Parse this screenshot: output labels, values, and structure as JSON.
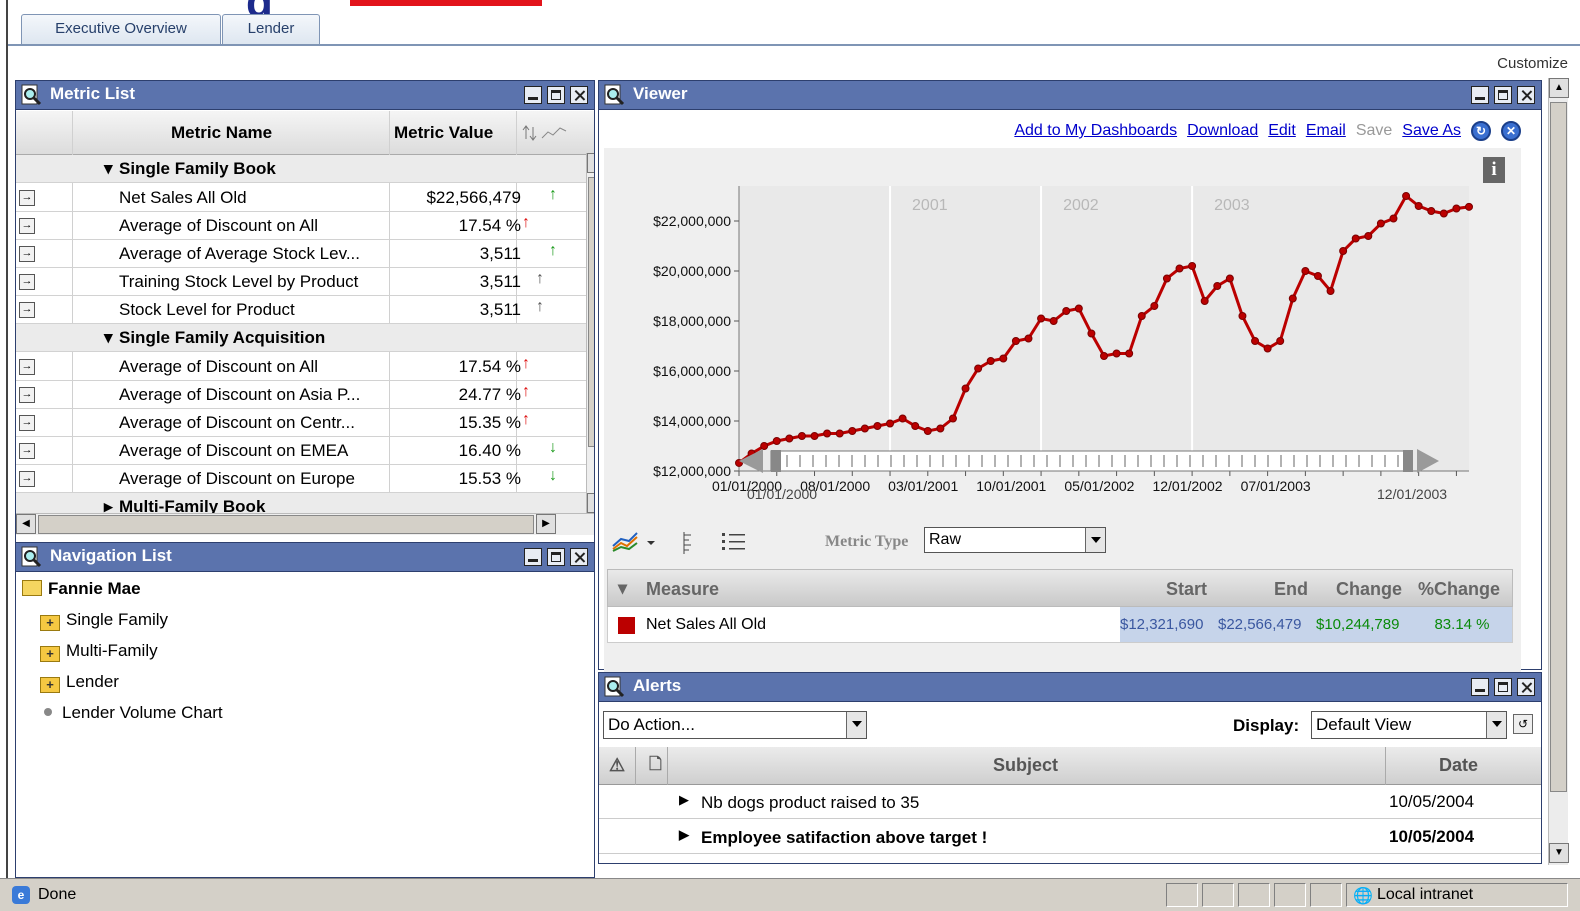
{
  "tabs": [
    "Executive Overview",
    "Lender"
  ],
  "customize_label": "Customize",
  "metric_list": {
    "title": "Metric List",
    "columns": {
      "name": "Metric Name",
      "value": "Metric Value"
    },
    "groups": [
      {
        "label": "Single Family Book",
        "expanded": true
      },
      {
        "label": "Single Family Acquisition",
        "expanded": true
      },
      {
        "label": "Multi-Family Book",
        "expanded": false
      }
    ],
    "rows_book": [
      {
        "name": "Net Sales All Old",
        "value": "$22,566,479",
        "trend": "up",
        "trend_color": "#1a9a1a"
      },
      {
        "name": "Average of Discount on All",
        "value": "17.54 %",
        "trend": "up",
        "trend_color": "#dd1111"
      },
      {
        "name": "Average of Average Stock Lev...",
        "value": "3,511",
        "trend": "up",
        "trend_color": "#1a9a1a"
      },
      {
        "name": "Training Stock Level by Product",
        "value": "3,511",
        "trend": "up",
        "trend_color": "#555555"
      },
      {
        "name": "Stock Level for Product",
        "value": "3,511",
        "trend": "up",
        "trend_color": "#555555"
      }
    ],
    "rows_acq": [
      {
        "name": "Average of Discount on All",
        "value": "17.54 %",
        "trend": "up",
        "trend_color": "#dd1111"
      },
      {
        "name": "Average of Discount on Asia P...",
        "value": "24.77 %",
        "trend": "up",
        "trend_color": "#dd1111"
      },
      {
        "name": "Average of Discount on Centr...",
        "value": "15.35 %",
        "trend": "up",
        "trend_color": "#dd1111"
      },
      {
        "name": "Average of Discount on EMEA",
        "value": "16.40 %",
        "trend": "down",
        "trend_color": "#1a9a1a"
      },
      {
        "name": "Average of Discount on Europe",
        "value": "15.53 %",
        "trend": "down",
        "trend_color": "#1a9a1a"
      }
    ]
  },
  "navigation": {
    "title": "Navigation List",
    "root": "Fannie Mae",
    "folders": [
      "Single Family",
      "Multi-Family",
      "Lender"
    ],
    "leaf": "Lender Volume Chart"
  },
  "viewer": {
    "title": "Viewer",
    "links": {
      "add": "Add to My Dashboards",
      "download": "Download",
      "edit": "Edit",
      "email": "Email",
      "save": "Save",
      "save_as": "Save As"
    },
    "range_start": "01/01/2000",
    "range_end": "12/01/2003",
    "metric_type_label": "Metric Type",
    "metric_type_value": "Raw",
    "table": {
      "headers": {
        "measure": "Measure",
        "start": "Start",
        "end": "End",
        "change": "Change",
        "pct": "%Change"
      },
      "row": {
        "measure": "Net Sales All Old",
        "start": "$12,321,690",
        "end": "$22,566,479",
        "change": "$10,244,789",
        "pct": "83.14 %"
      },
      "series_color": "#bb0000"
    }
  },
  "chart_data": {
    "type": "line",
    "title": "",
    "xlabel": "",
    "ylabel": "",
    "ylim": [
      12000000,
      23400000
    ],
    "yticks": [
      "$12,000,000",
      "$14,000,000",
      "$16,000,000",
      "$18,000,000",
      "$20,000,000",
      "$22,000,000"
    ],
    "ytick_values": [
      12000000,
      14000000,
      16000000,
      18000000,
      20000000,
      22000000
    ],
    "xtick_labels": [
      "01/01/2000",
      "08/01/2000",
      "03/01/2001",
      "10/01/2001",
      "05/01/2002",
      "12/01/2002",
      "07/01/2003"
    ],
    "year_bands": [
      "2001",
      "2002",
      "2003"
    ],
    "x_start": "01/2000",
    "x_end": "12/2003",
    "series": [
      {
        "values": [
          12321690,
          12700000,
          13000000,
          13200000,
          13300000,
          13400000,
          13400000,
          13500000,
          13500000,
          13600000,
          13700000,
          13800000,
          13900000,
          14100000,
          13800000,
          13600000,
          13700000,
          14100000,
          15300000,
          16100000,
          16400000,
          16500000,
          17200000,
          17300000,
          18100000,
          18000000,
          18400000,
          18500000,
          17500000,
          16600000,
          16700000,
          16700000,
          18200000,
          18600000,
          19700000,
          20100000,
          20200000,
          18800000,
          19400000,
          19700000,
          18200000,
          17200000,
          16900000,
          17200000,
          18900000,
          20000000,
          19800000,
          19200000,
          20800000,
          21300000,
          21400000,
          21900000,
          22100000,
          23000000,
          22600000,
          22400000,
          22300000,
          22500000,
          22566479
        ]
      }
    ],
    "series_color": "#bb0000",
    "grid": true
  },
  "alerts": {
    "title": "Alerts",
    "action_value": "Do Action...",
    "display_label": "Display:",
    "display_value": "Default View",
    "headers": {
      "subject": "Subject",
      "date": "Date"
    },
    "rows": [
      {
        "subject": "Nb dogs product raised to 35",
        "date": "10/05/2004",
        "bold": false
      },
      {
        "subject": "Employee satifaction above target !",
        "date": "10/05/2004",
        "bold": true
      }
    ]
  },
  "statusbar": {
    "text": "Done",
    "zone": "Local intranet"
  }
}
